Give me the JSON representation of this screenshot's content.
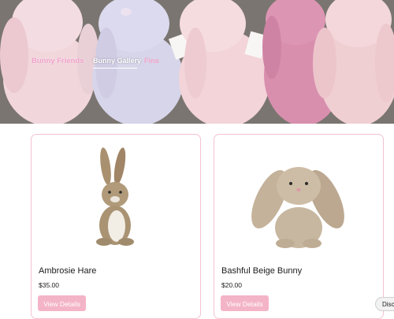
{
  "nav": {
    "brand": "Bunny Friends",
    "links": [
      {
        "label": "Bunny Gallery",
        "active": true
      },
      {
        "label": "Fina"
      }
    ]
  },
  "products": [
    {
      "name": "Ambrosie Hare",
      "price": "$35.00",
      "button": "View Details"
    },
    {
      "name": "Bashful Beige Bunny",
      "price": "$20.00",
      "button": "View Details"
    }
  ],
  "floating_button": {
    "label": "Disc"
  },
  "colors": {
    "accent_pink": "#f4b4c8",
    "card_border": "#f4c1d5",
    "brand_pink": "#f1a1c9"
  }
}
